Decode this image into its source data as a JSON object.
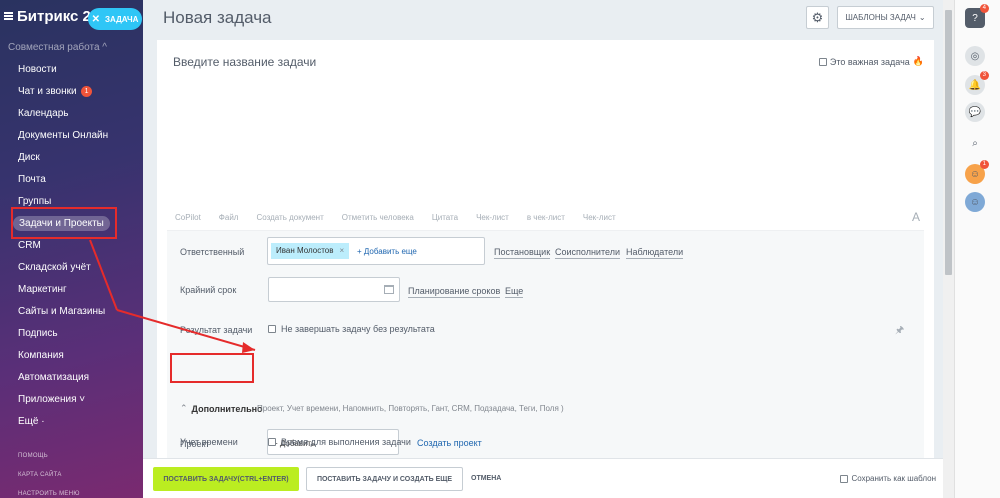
{
  "sidebar": {
    "logo": "Битрикс 24",
    "new_task_label": "ЗАДАЧА",
    "group_title": "Совместная работа ^",
    "items": [
      {
        "label": "Новости"
      },
      {
        "label": "Чат и звонки",
        "badge": "1"
      },
      {
        "label": "Календарь"
      },
      {
        "label": "Документы Онлайн"
      },
      {
        "label": "Диск"
      },
      {
        "label": "Почта"
      },
      {
        "label": "Группы"
      },
      {
        "label": "Задачи и Проекты",
        "active": true
      },
      {
        "label": "CRM"
      },
      {
        "label": "Складской учёт"
      },
      {
        "label": "Маркетинг"
      },
      {
        "label": "Сайты и Магазины"
      },
      {
        "label": "Подпись"
      },
      {
        "label": "Компания"
      },
      {
        "label": "Автоматизация"
      },
      {
        "label": "Приложения ˅"
      },
      {
        "label": "Ещё ·"
      }
    ],
    "help": "ПОМОЩЬ",
    "site_map": "КАРТА САЙТА",
    "menu_settings": "НАСТРОИТЬ МЕНЮ"
  },
  "header": {
    "title": "Новая задача",
    "templates_label": "ШАБЛОНЫ ЗАДАЧ"
  },
  "form": {
    "title_placeholder": "Введите название задачи",
    "important_label": "Это важная задача",
    "toolbar": [
      "CoPilot",
      "Файл",
      "Создать документ",
      "Отметить человека",
      "Цитата",
      "Чек-лист",
      "в чек-лист",
      "Чек-лист"
    ],
    "toolbar_right": "A",
    "responsible_label": "Ответственный",
    "responsible_chip": "Иван Молостов",
    "add_more": "+ Добавить еще",
    "role_links": [
      "Постановщик",
      "Соисполнители",
      "Наблюдатели"
    ],
    "deadline_label": "Крайний срок",
    "deadline_links": [
      "Планирование сроков",
      "Еще"
    ],
    "result_label": "Результат задачи",
    "result_checkbox": "Не завершать задачу без результата",
    "additional_label": "Дополнительно",
    "additional_list": "Проект,  Учет времени,  Напомнить,  Повторять,  Гант,  CRM,  Подзадача,  Теги,  Поля )",
    "project_label": "Проект",
    "project_add": "+ Добавить",
    "create_project": "Создать проект",
    "time_label": "Учет времени",
    "time_checkbox": "Время для выполнения задачи"
  },
  "footer": {
    "submit": "ПОСТАВИТЬ ЗАДАЧУ(CTRL+ENTER)",
    "submit_create": "ПОСТАВИТЬ ЗАДАЧУ И СОЗДАТЬ ЕЩЕ",
    "cancel": "ОТМЕНА",
    "save_template": "Сохранить как шаблон"
  },
  "rail": {
    "help_badge": "4",
    "bell_badge": "3",
    "avatar_badge": "1"
  },
  "colors": {
    "accent": "#2fc6f6",
    "submit": "#bbed21",
    "annotation": "#e52b2b",
    "link": "#2067b0"
  }
}
